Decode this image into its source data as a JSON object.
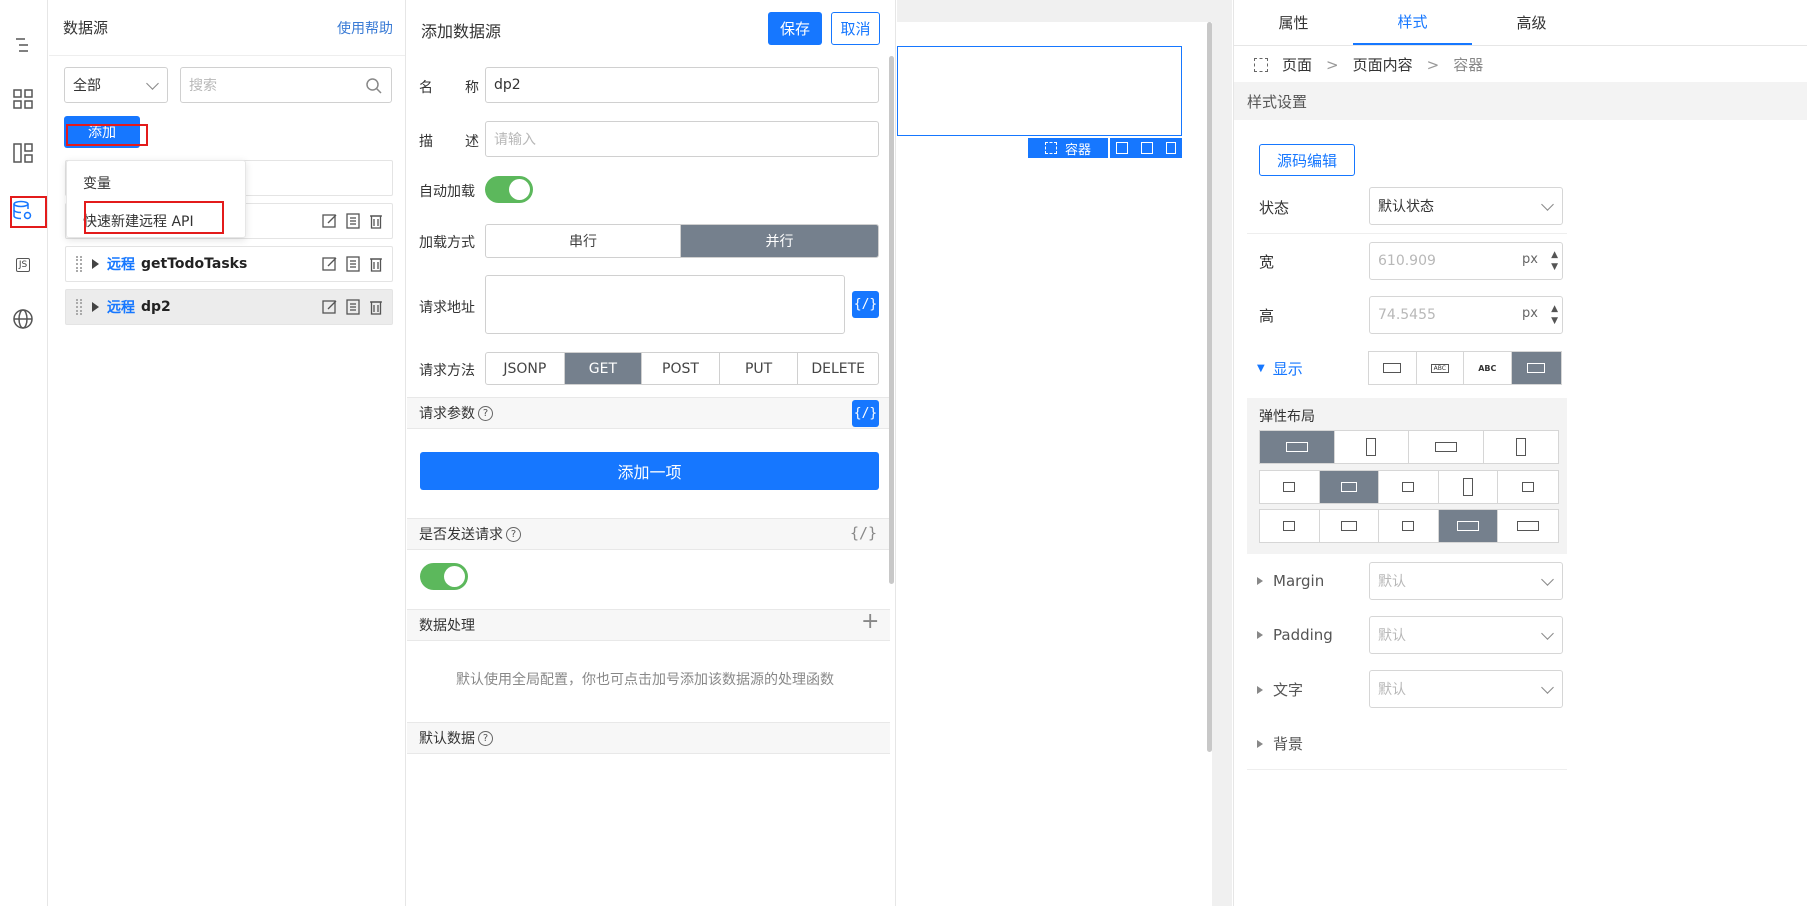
{
  "rail": {
    "icons": [
      "outline-icon",
      "components-icon",
      "layout-icon",
      "datasource-icon",
      "js-icon",
      "globe-icon"
    ],
    "js_label": "JS"
  },
  "datasource_panel": {
    "title": "数据源",
    "help_link": "使用帮助",
    "filter_value": "全部",
    "search_placeholder": "搜索",
    "add_button": "添加",
    "menu": {
      "item_variable": "变量",
      "item_quick_api": "快速新建远程 API"
    },
    "rows": [
      {
        "tag": "远程",
        "name": "getTodoTasks"
      },
      {
        "tag": "远程",
        "name": "dp2"
      }
    ]
  },
  "add_panel": {
    "title": "添加数据源",
    "save": "保存",
    "cancel": "取消",
    "name_label_a": "名",
    "name_label_b": "称",
    "name_value": "dp2",
    "desc_label_a": "描",
    "desc_label_b": "述",
    "desc_placeholder": "请输入",
    "autoload_label": "自动加载",
    "load_mode_label": "加载方式",
    "load_modes": [
      "串行",
      "并行"
    ],
    "url_label": "请求地址",
    "code_glyph": "{/}",
    "method_label": "请求方法",
    "methods": [
      "JSONP",
      "GET",
      "POST",
      "PUT",
      "DELETE"
    ],
    "params_label": "请求参数",
    "add_item": "添加一项",
    "send_label": "是否发送请求",
    "processing_label": "数据处理",
    "plus": "+",
    "processing_hint": "默认使用全局配置，你也可点击加号添加该数据源的处理函数",
    "default_data_label": "默认数据"
  },
  "canvas": {
    "container_label": "容器"
  },
  "props": {
    "tabs": [
      "属性",
      "样式",
      "高级"
    ],
    "breadcrumb": [
      "页面",
      "页面内容",
      "容器"
    ],
    "style_header": "样式设置",
    "source_edit": "源码编辑",
    "state_label": "状态",
    "state_value": "默认状态",
    "width_label": "宽",
    "width_value": "610.909",
    "height_label": "高",
    "height_value": "74.5455",
    "unit": "px",
    "display_label": "显示",
    "flex_label": "弹性布局",
    "margin_label": "Margin",
    "padding_label": "Padding",
    "text_label": "文字",
    "bg_label": "背景",
    "default_placeholder": "默认",
    "abc_small": "ABC",
    "abc_large": "ABC"
  }
}
